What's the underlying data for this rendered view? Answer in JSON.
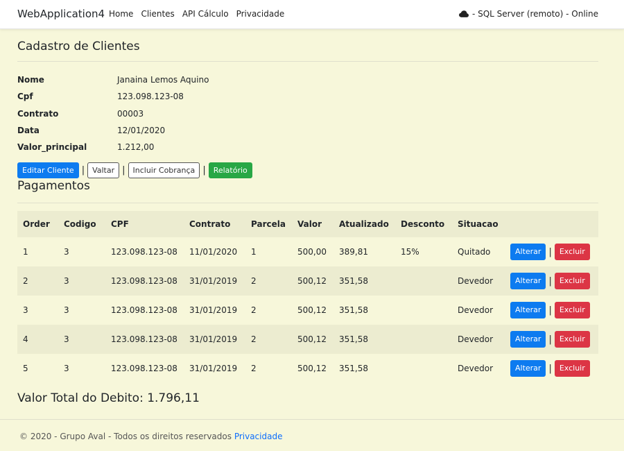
{
  "navbar": {
    "brand": "WebApplication4",
    "links": [
      "Home",
      "Clientes",
      "API Cálculo",
      "Privacidade"
    ],
    "status_text": "- SQL Server (remoto) - Online",
    "status_icon": "cloud-icon"
  },
  "page": {
    "title": "Cadastro de Clientes"
  },
  "details": [
    {
      "label": "Nome",
      "value": "Janaina Lemos Aquino"
    },
    {
      "label": "Cpf",
      "value": "123.098.123-08"
    },
    {
      "label": "Contrato",
      "value": "00003"
    },
    {
      "label": "Data",
      "value": "12/01/2020"
    },
    {
      "label": "Valor_principal",
      "value": "1.212,00"
    }
  ],
  "actions": {
    "edit": "Editar Cliente",
    "back": "Valtar",
    "add_charge": "Incluir Cobrança",
    "report": "Relatório",
    "separator": "|"
  },
  "payments": {
    "title": "Pagamentos",
    "columns": [
      "Order",
      "Codigo",
      "CPF",
      "Contrato",
      "Parcela",
      "Valor",
      "Atualizado",
      "Desconto",
      "Situacao",
      ""
    ],
    "rows": [
      {
        "order": "1",
        "codigo": "3",
        "cpf": "123.098.123-08",
        "contrato": "11/01/2020",
        "parcela": "1",
        "valor": "500,00",
        "atualizado": "389,81",
        "desconto": "15%",
        "situacao": "Quitado"
      },
      {
        "order": "2",
        "codigo": "3",
        "cpf": "123.098.123-08",
        "contrato": "31/01/2019",
        "parcela": "2",
        "valor": "500,12",
        "atualizado": "351,58",
        "desconto": "",
        "situacao": "Devedor"
      },
      {
        "order": "3",
        "codigo": "3",
        "cpf": "123.098.123-08",
        "contrato": "31/01/2019",
        "parcela": "2",
        "valor": "500,12",
        "atualizado": "351,58",
        "desconto": "",
        "situacao": "Devedor"
      },
      {
        "order": "4",
        "codigo": "3",
        "cpf": "123.098.123-08",
        "contrato": "31/01/2019",
        "parcela": "2",
        "valor": "500,12",
        "atualizado": "351,58",
        "desconto": "",
        "situacao": "Devedor"
      },
      {
        "order": "5",
        "codigo": "3",
        "cpf": "123.098.123-08",
        "contrato": "31/01/2019",
        "parcela": "2",
        "valor": "500,12",
        "atualizado": "351,58",
        "desconto": "",
        "situacao": "Devedor"
      }
    ],
    "row_actions": {
      "edit": "Alterar",
      "delete": "Excluir"
    }
  },
  "total": "Valor Total do Debito: 1.796,11",
  "footer": {
    "text": "© 2020 - Grupo Aval - Todos os direitos reservados",
    "link": "Privacidade"
  },
  "colors": {
    "background": "#f7f7da",
    "primary": "#0d7bf0",
    "success": "#28a745",
    "danger": "#dc3545",
    "table_stripe": "#ececd0"
  }
}
